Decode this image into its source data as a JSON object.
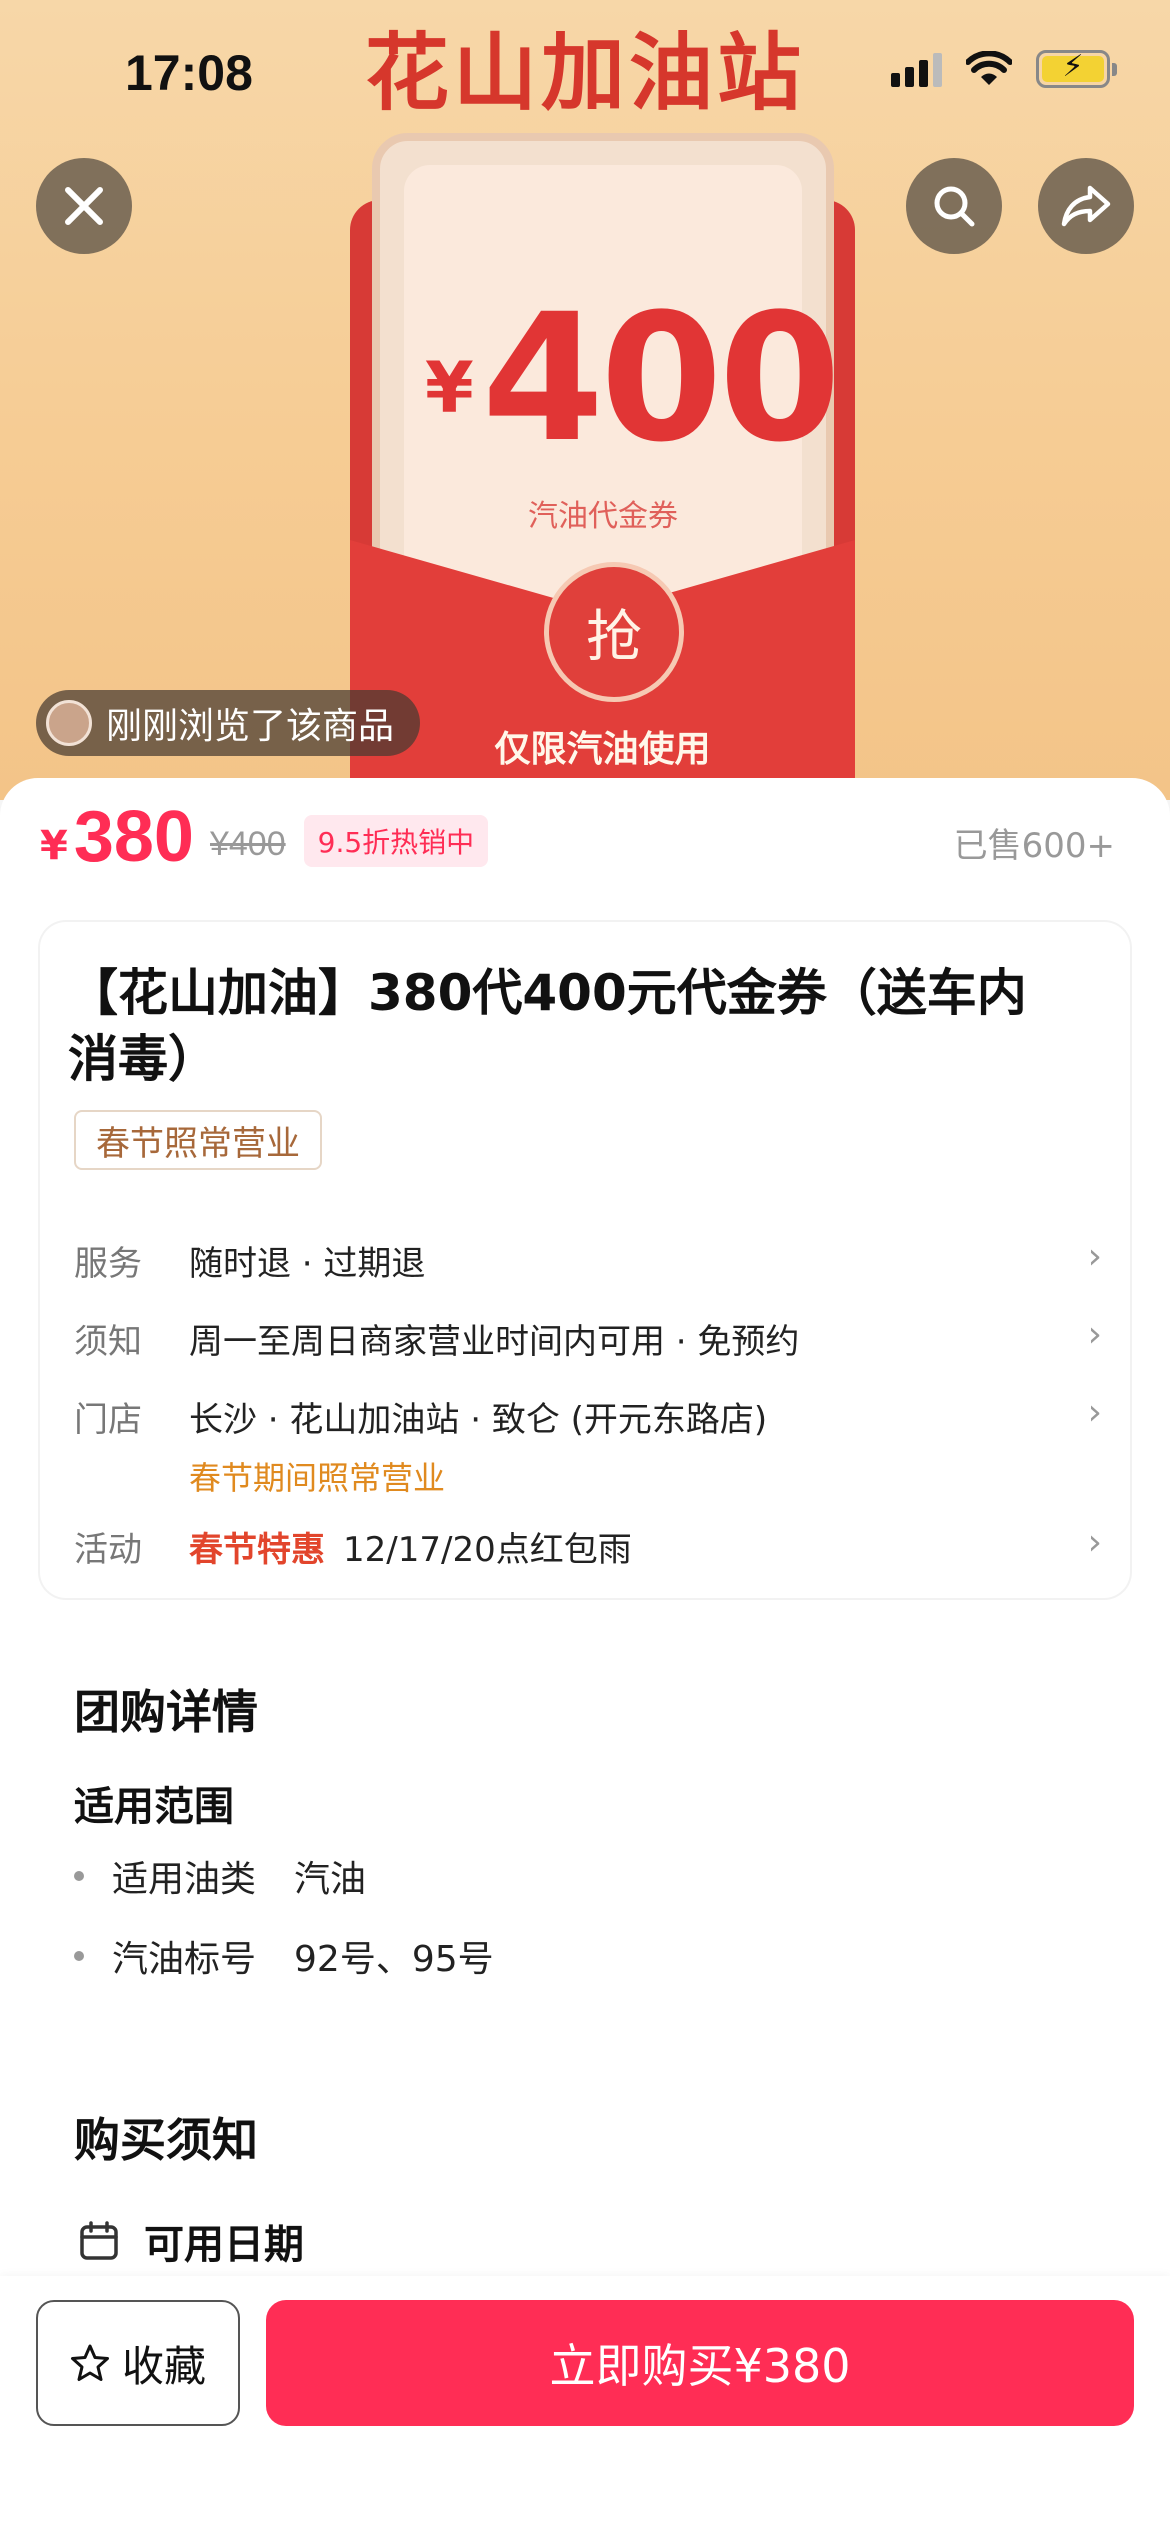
{
  "status_bar": {
    "time": "17:08"
  },
  "hero": {
    "title": "花山加油站",
    "voucher_yen": "¥",
    "voucher_amount": "400",
    "voucher_sub": "汽油代金券",
    "grab_label": "抢",
    "only_gas": "仅限汽油使用",
    "browsed_text": "刚刚浏览了该商品"
  },
  "toolbar": {
    "close_icon": "close-icon",
    "search_icon": "search-icon",
    "share_icon": "share-icon"
  },
  "price": {
    "currency": "¥",
    "current": "380",
    "original": "¥400",
    "discount_tag": "9.5折热销中",
    "sold": "已售600+"
  },
  "product": {
    "title": "【花山加油】380代400元代金券（送车内消毒）",
    "open_tag": "春节照常营业"
  },
  "info_rows": [
    {
      "key": "服务",
      "value": "随时退 · 过期退"
    },
    {
      "key": "须知",
      "value": "周一至周日商家营业时间内可用 · 免预约"
    },
    {
      "key": "门店",
      "value": "长沙 · 花山加油站 · 致仑 (开元东路店)",
      "sub": "春节期间照常营业"
    },
    {
      "key": "活动",
      "hot": "春节特惠",
      "value": "12/17/20点红包雨"
    }
  ],
  "group_detail": {
    "heading": "团购详情",
    "scope_heading": "适用范围",
    "items": [
      {
        "key": "适用油类",
        "value": "汽油"
      },
      {
        "key": "汽油标号",
        "value": "92号、95号"
      }
    ]
  },
  "purchase_notice": {
    "heading": "购买须知",
    "date_label": "可用日期"
  },
  "bottom_bar": {
    "favorite_label": "收藏",
    "buy_label": "立即购买¥380"
  },
  "colors": {
    "accent": "#ff2d55",
    "voucher_red": "#e13535",
    "hot_orange": "#e2452c",
    "notice_orange": "#e08a1f"
  }
}
